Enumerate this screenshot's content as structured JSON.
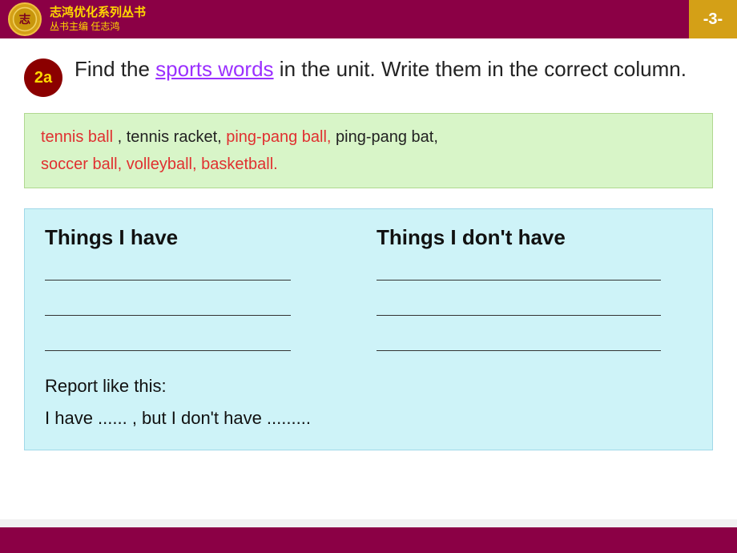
{
  "header": {
    "title_line1": "志鸿优化系列丛书",
    "title_line2": "丛书主编 任志鸿",
    "page_number": "-3-"
  },
  "exercise": {
    "number": "2a",
    "instruction_before": "Find the ",
    "instruction_link": "sports words",
    "instruction_after": " in the unit. Write them in the correct column."
  },
  "word_box": {
    "line1_red1": "tennis ball",
    "line1_sep1": " ,   ",
    "line1_normal1": "tennis racket,",
    "line1_red2": " ping-pang ball,",
    "line1_normal2": " ping-pang bat,",
    "line2_red1": "soccer ball,",
    "line2_sep": "   ",
    "line2_red2": "volleyball,",
    "line2_sep2": "    ",
    "line2_red3": "basketball."
  },
  "table": {
    "col_left_header": "Things I have",
    "col_right_header": "Things I don't have",
    "blanks_count": 3,
    "report_line1": "Report like this:",
    "report_line2": "I have ...... , but I don't have ........."
  }
}
